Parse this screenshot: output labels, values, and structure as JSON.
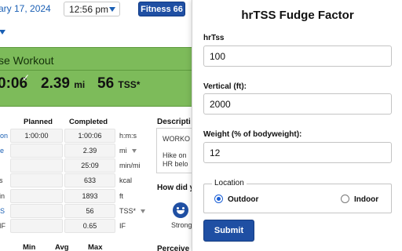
{
  "topbar": {
    "date": "ary 17, 2024",
    "time": "12:56 pm",
    "fitness_badge": "Fitness 66"
  },
  "workout": {
    "title": "se Workout",
    "duration": "0:06",
    "distance_value": "2.39",
    "distance_unit": "mi",
    "tss_value": "56",
    "tss_unit": "TSS*"
  },
  "table": {
    "headers": {
      "planned": "Planned",
      "completed": "Completed"
    },
    "rows": [
      {
        "label": "on",
        "link": true,
        "planned": "1:00:00",
        "completed": "1:00:06",
        "unit": "h:m:s",
        "has_caret": false
      },
      {
        "label": "e",
        "link": true,
        "planned": "",
        "completed": "2.39",
        "unit": "mi",
        "has_caret": true
      },
      {
        "label": "",
        "link": false,
        "planned": "",
        "completed": "25:09",
        "unit": "min/mi",
        "has_caret": false
      },
      {
        "label": "s",
        "link": false,
        "planned": "",
        "completed": "633",
        "unit": "kcal",
        "has_caret": false
      },
      {
        "label": "in",
        "link": false,
        "planned": "",
        "completed": "1893",
        "unit": "ft",
        "has_caret": false
      },
      {
        "label": "S",
        "link": true,
        "planned": "",
        "completed": "56",
        "unit": "TSS*",
        "has_caret": true
      },
      {
        "label": "IF",
        "link": false,
        "planned": "",
        "completed": "0.65",
        "unit": "IF",
        "has_caret": false
      }
    ],
    "bottom_headers": {
      "min": "Min",
      "avg": "Avg",
      "max": "Max"
    }
  },
  "description": {
    "title": "Descripti",
    "lines": [
      "WORKO",
      "Hike on",
      "HR belo"
    ]
  },
  "feel": {
    "question": "How did y",
    "strong_label": "Strong",
    "perceived": "Perceive"
  },
  "panel": {
    "title": "hrTSS Fudge Factor",
    "fields": {
      "hrtss": {
        "label": "hrTss",
        "value": "100"
      },
      "vertical": {
        "label": "Vertical (ft):",
        "value": "2000"
      },
      "weight": {
        "label": "Weight (% of bodyweight):",
        "value": "12"
      }
    },
    "location": {
      "legend": "Location",
      "outdoor": "Outdoor",
      "indoor": "Indoor",
      "selected": "Outdoor"
    },
    "submit_label": "Submit"
  },
  "colors": {
    "accent": "#1f4fa3",
    "banner_green": "#7dbb5a",
    "link_blue": "#1a5fb4",
    "radio_blue": "#1a5fd6"
  }
}
